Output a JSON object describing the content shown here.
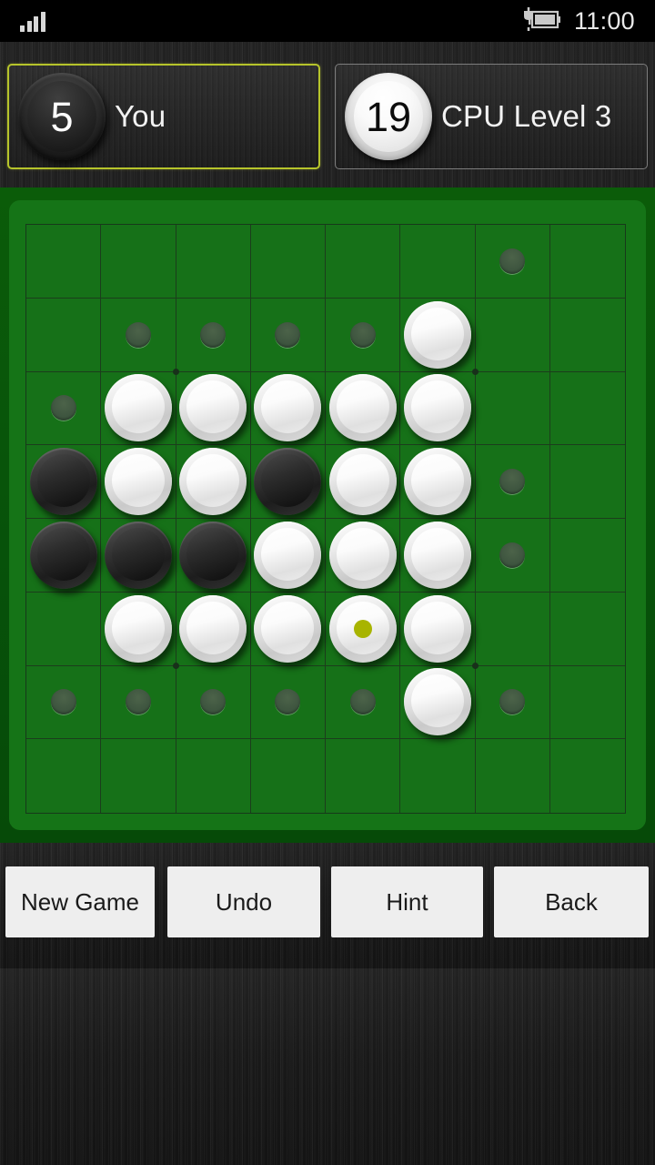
{
  "status_bar": {
    "time": "11:00",
    "signal_icon": "signal-bars-icon",
    "battery_icon": "battery-charging-icon"
  },
  "players": [
    {
      "name": "You",
      "score": "5",
      "disc_color": "black",
      "active": true,
      "border_color": "#b6c42b"
    },
    {
      "name": "CPU Level 3",
      "score": "19",
      "disc_color": "white",
      "active": false,
      "border_color": "#7d7d7d"
    }
  ],
  "board": {
    "rows": 8,
    "columns": 8,
    "board_color": "#167118",
    "frame_color": "#07520a",
    "grid_line_color": "#1c3d1c",
    "last_move_marker_color": "#a8b400",
    "hint_dot_color": "#3f5640",
    "legend": {
      "W": "white-disc",
      "B": "black-disc",
      "h": "hint-dot",
      "L": "white-disc-last-move",
      ".": "empty"
    },
    "cells": [
      [
        ".",
        ".",
        ".",
        ".",
        ".",
        ".",
        "h",
        "."
      ],
      [
        ".",
        "h",
        "h",
        "h",
        "h",
        "W",
        ".",
        "."
      ],
      [
        "h",
        "W",
        "W",
        "W",
        "W",
        "W",
        ".",
        "."
      ],
      [
        "B",
        "W",
        "W",
        "B",
        "W",
        "W",
        "h",
        "."
      ],
      [
        "B",
        "B",
        "B",
        "W",
        "W",
        "W",
        "h",
        "."
      ],
      [
        ".",
        "W",
        "W",
        "W",
        "L",
        "W",
        ".",
        "."
      ],
      [
        "h",
        "h",
        "h",
        "h",
        "h",
        "W",
        "h",
        "."
      ],
      [
        ".",
        ".",
        ".",
        ".",
        ".",
        ".",
        ".",
        "."
      ]
    ],
    "star_points": [
      [
        1,
        1
      ],
      [
        1,
        5
      ],
      [
        5,
        1
      ],
      [
        5,
        5
      ]
    ]
  },
  "buttons": [
    {
      "label": "New Game",
      "name": "new-game-button"
    },
    {
      "label": "Undo",
      "name": "undo-button"
    },
    {
      "label": "Hint",
      "name": "hint-button"
    },
    {
      "label": "Back",
      "name": "back-button"
    }
  ]
}
